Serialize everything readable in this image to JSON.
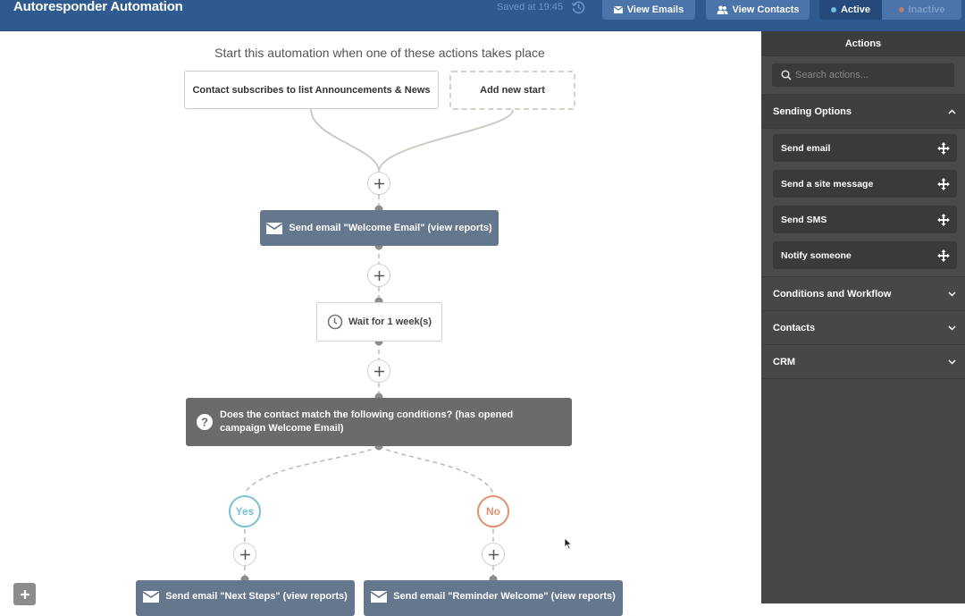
{
  "header": {
    "title": "Autoresponder Automation",
    "saved_text": "Saved at 19:45",
    "view_emails_label": "View Emails",
    "view_contacts_label": "View Contacts",
    "status_toggle": {
      "active_label": "Active",
      "inactive_label": "Inactive",
      "selected": "Active"
    }
  },
  "colors": {
    "header_bg": "#2f5a8f",
    "email_node": "#65778c",
    "condition_node": "#6b6b6b",
    "yes": "#79c0d6",
    "no": "#e09270",
    "active_dot": "#6cc0e0",
    "inactive_dot": "#b0826e"
  },
  "canvas": {
    "start_title": "Start this automation when one of these actions takes place",
    "triggers": [
      {
        "label": "Contact subscribes to list Announcements & News"
      }
    ],
    "add_start_label": "Add new start",
    "steps": {
      "email_welcome": "Send email \"Welcome Email\" (view reports)",
      "wait": "Wait for 1 week(s)",
      "condition": "Does the contact match the following conditions? (has opened campaign Welcome Email)",
      "yes_label": "Yes",
      "no_label": "No",
      "email_next_steps": "Send email \"Next Steps\" (view reports)",
      "email_reminder": "Send email \"Reminder Welcome\" (view reports)"
    }
  },
  "sidebar": {
    "title": "Actions",
    "search_placeholder": "Search actions...",
    "sections": [
      {
        "label": "Sending Options",
        "expanded": true,
        "items": [
          {
            "label": "Send email"
          },
          {
            "label": "Send a site message"
          },
          {
            "label": "Send SMS"
          },
          {
            "label": "Notify someone"
          }
        ]
      },
      {
        "label": "Conditions and Workflow",
        "expanded": false
      },
      {
        "label": "Contacts",
        "expanded": false
      },
      {
        "label": "CRM",
        "expanded": false
      }
    ]
  }
}
